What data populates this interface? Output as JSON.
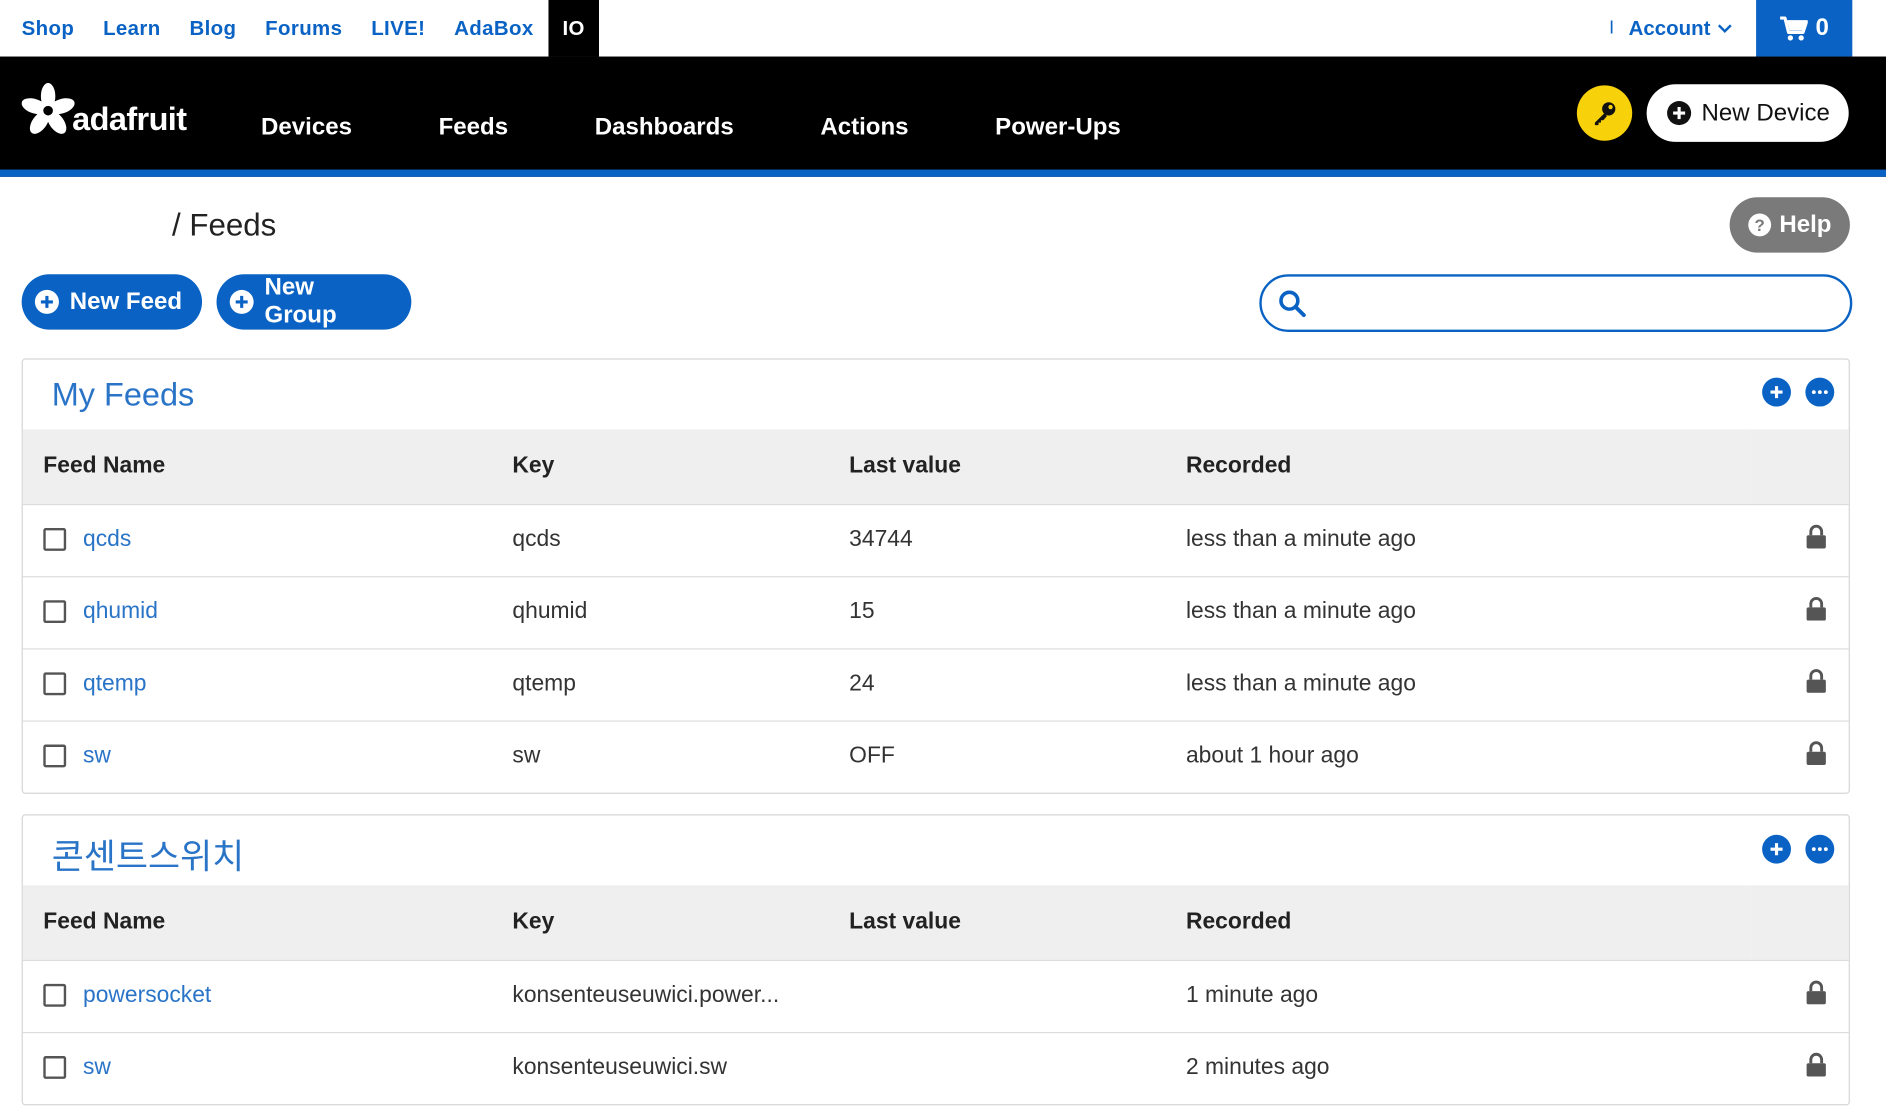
{
  "topnav": {
    "links": [
      "Shop",
      "Learn",
      "Blog",
      "Forums",
      "LIVE!",
      "AdaBox",
      "IO"
    ],
    "separator": "I",
    "account_label": "Account",
    "cart_count": "0"
  },
  "header": {
    "logo_text": "adafruit",
    "nav": [
      "Devices",
      "Feeds",
      "Dashboards",
      "Actions",
      "Power-Ups"
    ],
    "new_device_label": "New Device"
  },
  "page": {
    "breadcrumb": "/ Feeds",
    "help_label": "Help",
    "new_feed_label": "New Feed",
    "new_group_label": "New Group",
    "search_placeholder": ""
  },
  "groups": [
    {
      "title": "My Feeds",
      "columns": [
        "Feed Name",
        "Key",
        "Last value",
        "Recorded"
      ],
      "rows": [
        {
          "name": "qcds",
          "key": "qcds",
          "last_value": "34744",
          "recorded": "less than a minute ago"
        },
        {
          "name": "qhumid",
          "key": "qhumid",
          "last_value": "15",
          "recorded": "less than a minute ago"
        },
        {
          "name": "qtemp",
          "key": "qtemp",
          "last_value": "24",
          "recorded": "less than a minute ago"
        },
        {
          "name": "sw",
          "key": "sw",
          "last_value": "OFF",
          "recorded": "about 1 hour ago"
        }
      ]
    },
    {
      "title": "콘센트스위치",
      "columns": [
        "Feed Name",
        "Key",
        "Last value",
        "Recorded"
      ],
      "rows": [
        {
          "name": "powersocket",
          "key": "konsenteuseuwici.power...",
          "last_value": "",
          "recorded": "1 minute ago"
        },
        {
          "name": "sw",
          "key": "konsenteuseuwici.sw",
          "last_value": "",
          "recorded": "2 minutes ago"
        }
      ]
    }
  ],
  "colors": {
    "accent": "#0a63c4",
    "link": "#2a74c8",
    "key_button": "#f7d10a",
    "header_bg": "#000000",
    "help_bg": "#7a7a7a"
  },
  "icons": [
    "adafruit-star-logo",
    "cart-icon",
    "chevron-down-icon",
    "key-icon",
    "plus-circle-icon",
    "question-circle-icon",
    "search-icon",
    "more-icon",
    "lock-icon"
  ]
}
